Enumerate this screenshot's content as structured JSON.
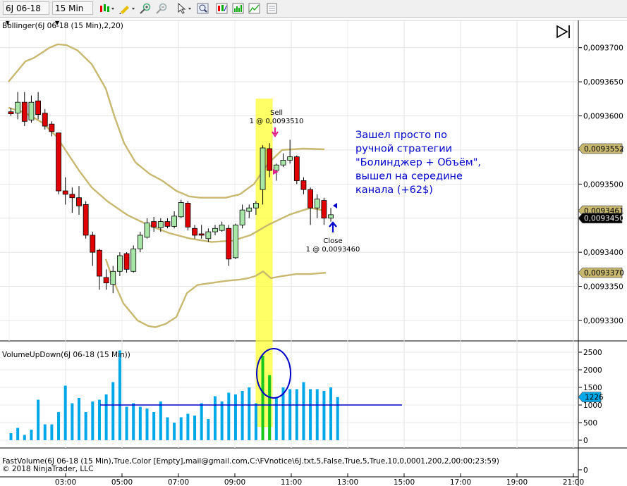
{
  "toolbar": {
    "instrument": "6J 06-18",
    "interval": "15 Min",
    "icons": [
      "bar-type-icon",
      "draw-pencil-icon",
      "zoom-in-icon",
      "zoom-out-icon",
      "cursor-icon",
      "magnifier-icon",
      "strategy-icon",
      "indicator-icon",
      "chart-properties-icon",
      "data-box-icon"
    ]
  },
  "chart_data": {
    "type": "candlestick",
    "indicator_label": "Bollinger(6J 06-18 (15 Min),2,20)",
    "x_ticks": [
      "03:00",
      "05:00",
      "07:00",
      "09:00",
      "11:00",
      "13:00",
      "15:00",
      "17:00",
      "19:00",
      "21:00"
    ],
    "y_ticks": [
      "0,0093700",
      "0,0093650",
      "0,0093600",
      "0,0093550",
      "0,0093500",
      "0,0093450",
      "0,0093400",
      "0,0093350",
      "0,0093300"
    ],
    "ylim": [
      0.009327,
      0.009374
    ],
    "price_badges": [
      {
        "text": "0,0093552",
        "value": 0.0093552,
        "color": "#c8b870"
      },
      {
        "text": "0,0093461",
        "value": 0.0093461,
        "color": "#c8b870"
      },
      {
        "text": "0,0093450",
        "value": 0.009345,
        "color": "#000000"
      },
      {
        "text": "0,0093370",
        "value": 0.009337,
        "color": "#c8b870"
      }
    ],
    "candles": [
      {
        "time": "02:00",
        "open": 0.0093606,
        "high": 0.0093612,
        "low": 0.00936,
        "close": 0.0093603
      },
      {
        "time": "02:15",
        "open": 0.0093604,
        "high": 0.0093635,
        "low": 0.0093595,
        "close": 0.009362
      },
      {
        "time": "02:30",
        "open": 0.009362,
        "high": 0.0093635,
        "low": 0.0093585,
        "close": 0.0093592
      },
      {
        "time": "02:45",
        "open": 0.0093594,
        "high": 0.009363,
        "low": 0.009359,
        "close": 0.009362
      },
      {
        "time": "03:00",
        "open": 0.0093622,
        "high": 0.0093635,
        "low": 0.0093595,
        "close": 0.0093602
      },
      {
        "time": "03:15",
        "open": 0.0093604,
        "high": 0.009361,
        "low": 0.009358,
        "close": 0.0093585
      },
      {
        "time": "03:30",
        "open": 0.0093588,
        "high": 0.0093592,
        "low": 0.009357,
        "close": 0.0093577
      },
      {
        "time": "03:45",
        "open": 0.0093575,
        "high": 0.0093575,
        "low": 0.0093485,
        "close": 0.009349
      },
      {
        "time": "04:00",
        "open": 0.009349,
        "high": 0.009351,
        "low": 0.009347,
        "close": 0.0093485
      },
      {
        "time": "04:15",
        "open": 0.0093485,
        "high": 0.0093495,
        "low": 0.0093458,
        "close": 0.009348
      },
      {
        "time": "04:30",
        "open": 0.009348,
        "high": 0.0093497,
        "low": 0.0093455,
        "close": 0.0093468
      },
      {
        "time": "04:45",
        "open": 0.009347,
        "high": 0.0093475,
        "low": 0.009342,
        "close": 0.0093425
      },
      {
        "time": "05:00",
        "open": 0.0093425,
        "high": 0.009343,
        "low": 0.009338,
        "close": 0.00934
      },
      {
        "time": "05:15",
        "open": 0.0093403,
        "high": 0.0093405,
        "low": 0.0093345,
        "close": 0.0093365
      },
      {
        "time": "05:30",
        "open": 0.0093363,
        "high": 0.0093375,
        "low": 0.0093345,
        "close": 0.0093355
      },
      {
        "time": "05:45",
        "open": 0.0093353,
        "high": 0.009338,
        "low": 0.009334,
        "close": 0.0093372
      },
      {
        "time": "06:00",
        "open": 0.0093372,
        "high": 0.00934,
        "low": 0.0093365,
        "close": 0.0093395
      },
      {
        "time": "06:15",
        "open": 0.0093398,
        "high": 0.00934,
        "low": 0.009337,
        "close": 0.0093375
      },
      {
        "time": "06:30",
        "open": 0.0093372,
        "high": 0.009341,
        "low": 0.009337,
        "close": 0.0093405
      },
      {
        "time": "06:45",
        "open": 0.0093405,
        "high": 0.009343,
        "low": 0.00934,
        "close": 0.0093425
      },
      {
        "time": "07:00",
        "open": 0.0093422,
        "high": 0.009345,
        "low": 0.009342,
        "close": 0.0093443
      },
      {
        "time": "07:15",
        "open": 0.0093445,
        "high": 0.0093452,
        "low": 0.009343,
        "close": 0.0093437
      },
      {
        "time": "07:30",
        "open": 0.0093436,
        "high": 0.009345,
        "low": 0.009343,
        "close": 0.0093445
      },
      {
        "time": "07:45",
        "open": 0.0093445,
        "high": 0.009345,
        "low": 0.0093435,
        "close": 0.0093438
      },
      {
        "time": "08:00",
        "open": 0.0093438,
        "high": 0.009346,
        "low": 0.0093435,
        "close": 0.0093453
      },
      {
        "time": "08:15",
        "open": 0.0093452,
        "high": 0.0093477,
        "low": 0.009345,
        "close": 0.0093473
      },
      {
        "time": "08:30",
        "open": 0.0093472,
        "high": 0.0093475,
        "low": 0.0093432,
        "close": 0.0093437
      },
      {
        "time": "08:45",
        "open": 0.0093435,
        "high": 0.009344,
        "low": 0.009342,
        "close": 0.0093425
      },
      {
        "time": "09:00",
        "open": 0.0093427,
        "high": 0.009344,
        "low": 0.009342,
        "close": 0.0093425
      },
      {
        "time": "09:15",
        "open": 0.009342,
        "high": 0.0093435,
        "low": 0.0093415,
        "close": 0.009343
      },
      {
        "time": "09:30",
        "open": 0.009343,
        "high": 0.009344,
        "low": 0.0093425,
        "close": 0.0093435
      },
      {
        "time": "09:45",
        "open": 0.0093432,
        "high": 0.0093445,
        "low": 0.009343,
        "close": 0.009344
      },
      {
        "time": "10:00",
        "open": 0.0093435,
        "high": 0.009344,
        "low": 0.009338,
        "close": 0.009339
      },
      {
        "time": "10:15",
        "open": 0.0093392,
        "high": 0.0093442,
        "low": 0.009339,
        "close": 0.009344
      },
      {
        "time": "10:30",
        "open": 0.009344,
        "high": 0.009347,
        "low": 0.0093435,
        "close": 0.0093462
      },
      {
        "time": "10:45",
        "open": 0.009346,
        "high": 0.009347,
        "low": 0.009345,
        "close": 0.0093465
      },
      {
        "time": "11:00",
        "open": 0.0093465,
        "high": 0.0093475,
        "low": 0.0093455,
        "close": 0.0093472
      },
      {
        "time": "11:15",
        "open": 0.0093492,
        "high": 0.0093557,
        "low": 0.009347,
        "close": 0.0093553
      },
      {
        "time": "11:30",
        "open": 0.0093552,
        "high": 0.009356,
        "low": 0.009351,
        "close": 0.009352
      },
      {
        "time": "11:45",
        "open": 0.009352,
        "high": 0.009353,
        "low": 0.0093505,
        "close": 0.0093528
      },
      {
        "time": "12:00",
        "open": 0.0093528,
        "high": 0.0093545,
        "low": 0.0093525,
        "close": 0.0093535
      },
      {
        "time": "12:15",
        "open": 0.0093535,
        "high": 0.0093565,
        "low": 0.009353,
        "close": 0.009354
      },
      {
        "time": "12:30",
        "open": 0.009354,
        "high": 0.0093542,
        "low": 0.00935,
        "close": 0.0093505
      },
      {
        "time": "12:45",
        "open": 0.0093505,
        "high": 0.009351,
        "low": 0.0093485,
        "close": 0.0093492
      },
      {
        "time": "13:00",
        "open": 0.0093492,
        "high": 0.0093495,
        "low": 0.009344,
        "close": 0.0093465
      },
      {
        "time": "13:15",
        "open": 0.0093465,
        "high": 0.0093485,
        "low": 0.009345,
        "close": 0.0093478
      },
      {
        "time": "13:30",
        "open": 0.0093476,
        "high": 0.009348,
        "low": 0.009344,
        "close": 0.009345
      },
      {
        "time": "13:45",
        "open": 0.009345,
        "high": 0.0093465,
        "low": 0.0093445,
        "close": 0.0093455
      }
    ],
    "bollinger": {
      "upper": [
        0.009365,
        0.0093665,
        0.009368,
        0.0093685,
        0.0093693,
        0.00937,
        0.0093705,
        0.0093704,
        0.0093696,
        0.0093676,
        0.009364,
        0.00936,
        0.009356,
        0.0093532,
        0.0093515,
        0.0093505,
        0.009349,
        0.0093482,
        0.009348,
        0.009348,
        0.009348,
        0.0093485,
        0.00935,
        0.009353,
        0.009355,
        0.0093552,
        0.0093551
      ],
      "middle": [
        0.0093612,
        0.0093605,
        0.009359,
        0.009357,
        0.0093545,
        0.009352,
        0.0093495,
        0.0093475,
        0.0093455,
        0.009344,
        0.0093428,
        0.009342,
        0.0093415,
        0.0093417,
        0.0093425,
        0.009344,
        0.0093455,
        0.0093465,
        0.0093461
      ],
      "lower": [
        0.009339,
        0.009336,
        0.0093325,
        0.00933,
        0.0093292,
        0.009329,
        0.0093295,
        0.0093305,
        0.009334,
        0.0093352,
        0.0093355,
        0.0093358,
        0.009336,
        0.0093362,
        0.0093365,
        0.0093372,
        0.0093362,
        0.0093365,
        0.0093368,
        0.0093368,
        0.009337
      ]
    },
    "volume_label": "VolumeUpDown(6J 06-18 (15 Min))",
    "volume_ticks": [
      "2500",
      "2000",
      "1500",
      "1000",
      "500",
      "0"
    ],
    "volume_ylim": [
      0,
      2700
    ],
    "volume": [
      200,
      350,
      150,
      300,
      1150,
      450,
      450,
      800,
      1550,
      1050,
      1200,
      800,
      1100,
      1150,
      1300,
      1650,
      2550,
      950,
      1050,
      950,
      900,
      800,
      1100,
      650,
      500,
      650,
      750,
      700,
      1050,
      600,
      1250,
      1100,
      1350,
      1300,
      1400,
      1500,
      1050,
      1750,
      1800,
      1200,
      1500,
      1450,
      1450,
      1650,
      1450,
      1450,
      1400,
      1500,
      1226
    ],
    "volume_down": [
      0,
      0,
      0,
      0,
      0,
      0,
      0,
      0,
      0,
      0,
      0,
      0,
      0,
      0,
      0,
      0,
      0,
      0,
      0,
      0,
      0,
      0,
      0,
      0,
      0,
      0,
      0,
      0,
      0,
      0,
      0,
      0,
      0,
      0,
      0,
      0,
      0,
      2400,
      1850,
      0,
      0,
      0,
      0,
      0,
      0,
      0,
      0,
      0,
      0
    ],
    "volume_badge": "1226",
    "volume_threshold": 1000,
    "trade_sell": {
      "label": "Sell",
      "detail": "1 @ 0,0093510"
    },
    "trade_close": {
      "label": "Close",
      "detail": "1 @ 0,0093460"
    },
    "annotation": "Зашел просто по ручной стратегии \"Болинджер + Объём\", вышел на середине канала (+62$)",
    "footer_line1": "FastVolume(6J 06-18 (15 Min),True,Color [Empty],mail@gmail.com,C:\\FVnotice\\6J.txt,5,False,True,5,True,10,0,0001,200,2,00:00;23:59)",
    "footer_line2": "© 2018 NinjaTrader, LLC"
  },
  "colors": {
    "up": "#a8e6a8",
    "down": "#e00000",
    "volume": "#00a8e8",
    "volume_down": "#19c819",
    "bollinger": "#c8b870",
    "highlight": "#ffff33",
    "annotation": "#0000cc"
  }
}
